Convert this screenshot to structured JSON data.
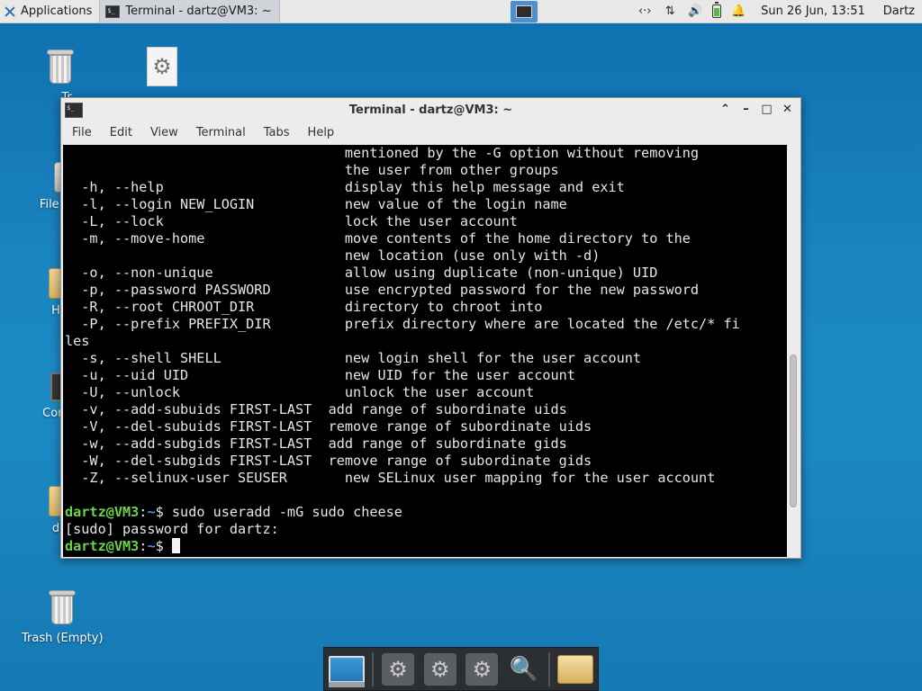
{
  "top_panel": {
    "apps_label": "Applications",
    "task_label": "Terminal - dartz@VM3: ~",
    "clock": "Sun 26 Jun, 13:51",
    "user": "Dartz",
    "tray_icons": [
      "network-arrows-icon",
      "updown-arrows-icon",
      "volume-icon",
      "battery-icon",
      "notification-bell-icon"
    ]
  },
  "desktop": {
    "icons": [
      {
        "name": "trash-top",
        "label": "Tr"
      },
      {
        "name": "file-system",
        "label": "File S"
      },
      {
        "name": "home",
        "label": "Ho"
      },
      {
        "name": "computer",
        "label": "Com"
      },
      {
        "name": "dartz-folder",
        "label": "da"
      },
      {
        "name": "trash-empty",
        "label": "Trash (Empty)"
      }
    ]
  },
  "terminal": {
    "title": "Terminal - dartz@VM3: ~",
    "menu": [
      "File",
      "Edit",
      "View",
      "Terminal",
      "Tabs",
      "Help"
    ],
    "output_lines": [
      "                                  mentioned by the -G option without removing",
      "                                  the user from other groups",
      "  -h, --help                      display this help message and exit",
      "  -l, --login NEW_LOGIN           new value of the login name",
      "  -L, --lock                      lock the user account",
      "  -m, --move-home                 move contents of the home directory to the",
      "                                  new location (use only with -d)",
      "  -o, --non-unique                allow using duplicate (non-unique) UID",
      "  -p, --password PASSWORD         use encrypted password for the new password",
      "  -R, --root CHROOT_DIR           directory to chroot into",
      "  -P, --prefix PREFIX_DIR         prefix directory where are located the /etc/* fi",
      "les",
      "  -s, --shell SHELL               new login shell for the user account",
      "  -u, --uid UID                   new UID for the user account",
      "  -U, --unlock                    unlock the user account",
      "  -v, --add-subuids FIRST-LAST  add range of subordinate uids",
      "  -V, --del-subuids FIRST-LAST  remove range of subordinate uids",
      "  -w, --add-subgids FIRST-LAST  add range of subordinate gids",
      "  -W, --del-subgids FIRST-LAST  remove range of subordinate gids",
      "  -Z, --selinux-user SEUSER       new SELinux user mapping for the user account",
      ""
    ],
    "prompt_user": "dartz@VM3",
    "prompt_path": "~",
    "prompt_symbol": "$",
    "command": " sudo useradd -mG sudo cheese",
    "sudo_prompt": "[sudo] password for dartz:",
    "scroll_position": 0.82
  },
  "dock": {
    "items": [
      "desktop-screen-icon",
      "settings-gear-icon",
      "settings-gear-icon",
      "settings-gear-icon",
      "search-magnifier-icon",
      "folder-icon"
    ]
  }
}
